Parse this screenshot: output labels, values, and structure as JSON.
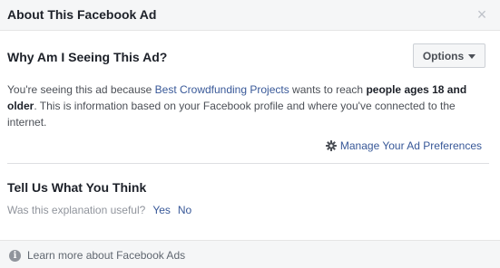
{
  "header": {
    "title": "About This Facebook Ad",
    "close_glyph": "×"
  },
  "why": {
    "title": "Why Am I Seeing This Ad?",
    "options_label": "Options",
    "text_1": "You're seeing this ad because ",
    "advertiser": "Best Crowdfunding Projects",
    "text_2": " wants to reach ",
    "audience": "people ages 18 and older",
    "text_3": ". This is information based on your Facebook profile and where you've connected to the internet.",
    "manage_label": "Manage Your Ad Preferences"
  },
  "feedback": {
    "title": "Tell Us What You Think",
    "question": "Was this explanation useful?",
    "yes_label": "Yes",
    "no_label": "No"
  },
  "footer": {
    "info_glyph": "i",
    "link_label": "Learn more about Facebook Ads"
  },
  "colors": {
    "link": "#385898",
    "header_bg": "#f5f6f7",
    "text": "#1d2129"
  },
  "icons": [
    "close-icon",
    "caret-down-icon",
    "gear-icon",
    "info-icon"
  ]
}
